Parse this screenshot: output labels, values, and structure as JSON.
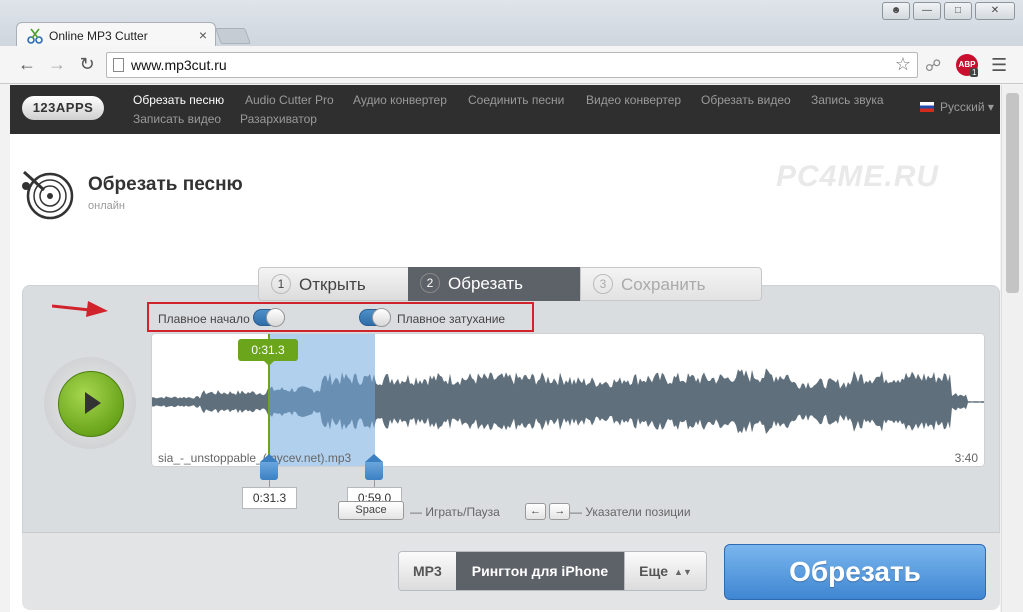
{
  "browser": {
    "tab_title": "Online MP3 Cutter",
    "tab_close": "×",
    "url": "www.mp3cut.ru",
    "abp_label": "ABP",
    "abp_count": "1"
  },
  "site": {
    "logo": "123APPS",
    "nav": [
      "Обрезать песню",
      "Audio Cutter Pro",
      "Аудио конвертер",
      "Соединить песни",
      "Видео конвертер",
      "Обрезать видео",
      "Запись звука",
      "Записать видео",
      "Разархиватор"
    ],
    "language": "Русский",
    "watermark": "PC4ME.RU"
  },
  "app": {
    "title": "Обрезать песню",
    "subtitle": "онлайн"
  },
  "steps": [
    {
      "num": "1",
      "label": "Открыть"
    },
    {
      "num": "2",
      "label": "Обрезать"
    },
    {
      "num": "3",
      "label": "Сохранить"
    }
  ],
  "editor": {
    "fade_in_label": "Плавное начало",
    "fade_out_label": "Плавное затухание",
    "file_name": "sia_-_unstoppable_(mycev.net).mp3",
    "duration": "3:40",
    "position_bubble": "0:31.3",
    "start_time": "0:31.3",
    "end_time": "0:59.0",
    "space_key": "Space",
    "play_pause_hint": "— Играть/Пауза",
    "arrow_left_key": "←",
    "arrow_right_key": "→",
    "position_hint": "— Указатели позиции"
  },
  "output": {
    "formats": [
      "MP3",
      "Рингтон для iPhone",
      "Еще"
    ],
    "selected_format": "Рингтон для iPhone",
    "cut_button": "Обрезать"
  },
  "colors": {
    "accent_blue": "#3f86d2",
    "play_green": "#6aa51b",
    "highlight_red": "#d0232c",
    "header_dark": "#2f2f2f"
  }
}
